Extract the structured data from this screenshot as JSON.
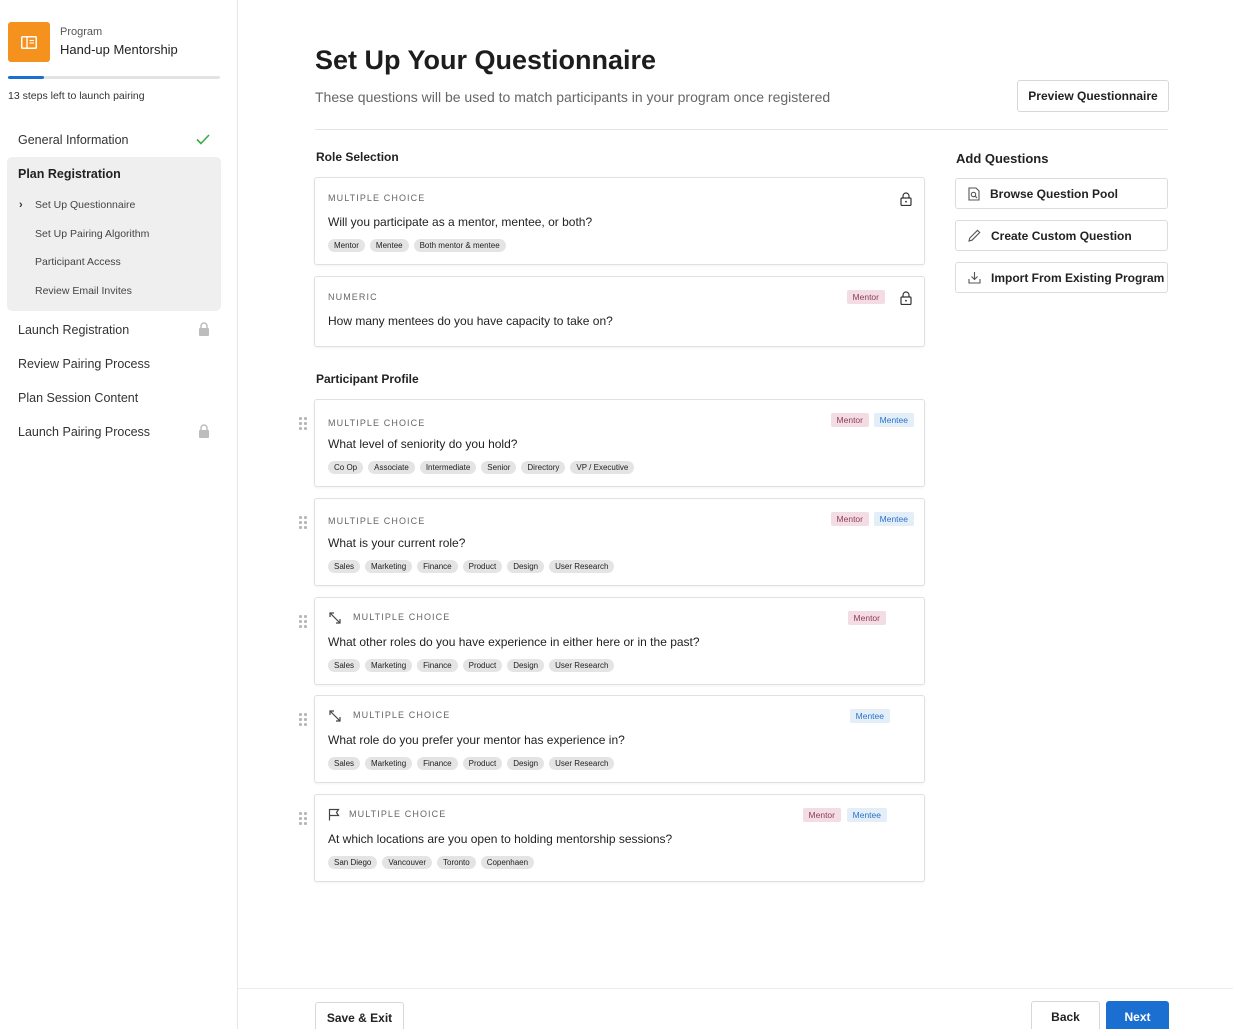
{
  "sidebar": {
    "program_label": "Program",
    "program_name": "Hand-up Mentorship",
    "progress_fraction": 0.17,
    "steps_left": "13 steps left to launch pairing",
    "items": [
      {
        "label": "General Information",
        "status": "complete"
      },
      {
        "label": "Plan Registration",
        "status": "active",
        "sub_items": [
          {
            "label": "Set Up Questionnaire",
            "active": true
          },
          {
            "label": "Set Up Pairing Algorithm"
          },
          {
            "label": "Participant Access"
          },
          {
            "label": "Review Email Invites"
          }
        ]
      },
      {
        "label": "Launch Registration",
        "status": "locked"
      },
      {
        "label": "Review Pairing Process",
        "status": "open"
      },
      {
        "label": "Plan Session Content",
        "status": "open"
      },
      {
        "label": "Launch Pairing Process",
        "status": "locked"
      }
    ]
  },
  "header": {
    "title": "Set Up Your Questionnaire",
    "subtitle": "These questions will be used to match participants in your program once registered",
    "preview_button": "Preview Questionnaire"
  },
  "role_selection": {
    "title": "Role Selection",
    "questions": [
      {
        "type": "MULTIPLE CHOICE",
        "question": "Will you participate as a mentor, mentee, or both?",
        "options": [
          "Mentor",
          "Mentee",
          "Both mentor & mentee"
        ],
        "locked": true,
        "badges": []
      },
      {
        "type": "NUMERIC",
        "question": "How many mentees do you have capacity to take on?",
        "options": [],
        "locked": true,
        "badges": [
          "Mentor"
        ]
      }
    ]
  },
  "participant_profile": {
    "title": "Participant Profile",
    "questions": [
      {
        "type": "MULTIPLE CHOICE",
        "icon": "",
        "question": "What level of seniority do you hold?",
        "options": [
          "Co Op",
          "Associate",
          "Intermediate",
          "Senior",
          "Directory",
          "VP / Executive"
        ],
        "badges": [
          "Mentor",
          "Mentee"
        ]
      },
      {
        "type": "MULTIPLE CHOICE",
        "icon": "",
        "question": "What is your current role?",
        "options": [
          "Sales",
          "Marketing",
          "Finance",
          "Product",
          "Design",
          "User Research"
        ],
        "badges": [
          "Mentor",
          "Mentee"
        ]
      },
      {
        "type": "MULTIPLE CHOICE",
        "icon": "match-arrows-icon",
        "question": "What other roles do you have experience in either here or in the past?",
        "options": [
          "Sales",
          "Marketing",
          "Finance",
          "Product",
          "Design",
          "User Research"
        ],
        "badges": [
          "Mentor"
        ]
      },
      {
        "type": "MULTIPLE CHOICE",
        "icon": "match-arrows-icon",
        "question": "What role do you prefer your mentor has experience in?",
        "options": [
          "Sales",
          "Marketing",
          "Finance",
          "Product",
          "Design",
          "User Research"
        ],
        "badges": [
          "Mentee"
        ]
      },
      {
        "type": "MULTIPLE CHOICE",
        "icon": "flag-icon",
        "question": "At which locations are you open to holding mentorship sessions?",
        "options": [
          "San Diego",
          "Vancouver",
          "Toronto",
          "Copenhaen"
        ],
        "badges": [
          "Mentor",
          "Mentee"
        ]
      }
    ]
  },
  "add_questions": {
    "title": "Add Questions",
    "buttons": [
      {
        "label": "Browse Question Pool",
        "icon": "search-document-icon"
      },
      {
        "label": "Create Custom Question",
        "icon": "pencil-icon"
      },
      {
        "label": "Import From Existing Program",
        "icon": "import-icon"
      }
    ]
  },
  "footer": {
    "save_exit": "Save & Exit",
    "back": "Back",
    "next": "Next"
  },
  "colors": {
    "accent": "#1b6fd1",
    "program_icon": "#f5921e",
    "mentor_badge_bg": "#f4dce5",
    "mentee_badge_bg": "#e3eef9",
    "check": "#3daa4a"
  }
}
